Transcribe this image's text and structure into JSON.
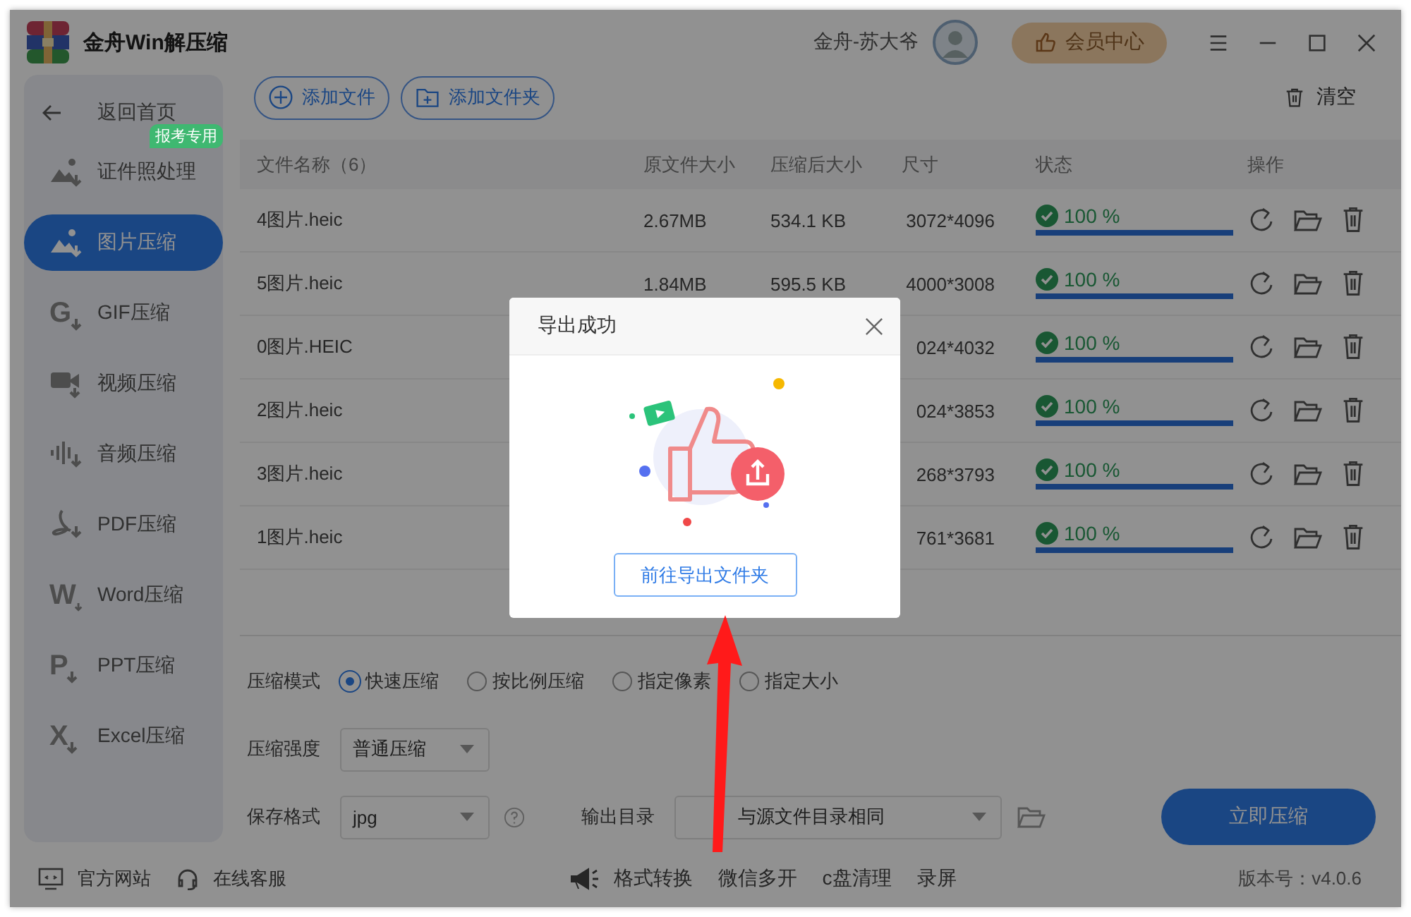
{
  "app": {
    "title": "金舟Win解压缩",
    "user": "金舟-苏大爷",
    "vip_button": "会员中心"
  },
  "sidebar": {
    "back": "返回首页",
    "items": [
      {
        "label": "证件照处理",
        "selected": false,
        "kind": "photo",
        "badge": "报考专用"
      },
      {
        "label": "图片压缩",
        "selected": true,
        "kind": "photo"
      },
      {
        "label": "GIF压缩",
        "selected": false,
        "kind": "letter",
        "icon_letter": "G"
      },
      {
        "label": "视频压缩",
        "selected": false,
        "kind": "video"
      },
      {
        "label": "音频压缩",
        "selected": false,
        "kind": "audio"
      },
      {
        "label": "PDF压缩",
        "selected": false,
        "kind": "pdf"
      },
      {
        "label": "Word压缩",
        "selected": false,
        "kind": "letter",
        "icon_letter": "W"
      },
      {
        "label": "PPT压缩",
        "selected": false,
        "kind": "letter",
        "icon_letter": "P"
      },
      {
        "label": "Excel压缩",
        "selected": false,
        "kind": "letter",
        "icon_letter": "X"
      }
    ]
  },
  "toolbar": {
    "add_file": "添加文件",
    "add_folder": "添加文件夹",
    "clear": "清空"
  },
  "table": {
    "columns": [
      "文件名称（6）",
      "原文件大小",
      "压缩后大小",
      "尺寸",
      "状态",
      "操作"
    ],
    "rows": [
      {
        "name": "4图片.heic",
        "original_size": "2.67MB",
        "compressed_size": "534.1 KB",
        "dimensions": "3072*4096",
        "status": "100 %",
        "level": 1
      },
      {
        "name": "5图片.heic",
        "original_size": "1.84MB",
        "compressed_size": "595.5 KB",
        "dimensions": "4000*3008",
        "status": "100 %",
        "level": 1
      },
      {
        "name": "0图片.HEIC",
        "dimensions": "024*4032",
        "status": "100 %",
        "level": 1
      },
      {
        "name": "2图片.heic",
        "dimensions": "024*3853",
        "status": "100 %",
        "level": 1
      },
      {
        "name": "3图片.heic",
        "dimensions": "268*3793",
        "status": "100 %",
        "level": 1
      },
      {
        "name": "1图片.heic",
        "dimensions": "761*3681",
        "status": "100 %",
        "level": 1
      }
    ]
  },
  "settings": {
    "mode_label": "压缩模式",
    "modes": [
      {
        "label": "快速压缩",
        "selected": true
      },
      {
        "label": "按比例压缩",
        "selected": false
      },
      {
        "label": "指定像素",
        "selected": false
      },
      {
        "label": "指定大小",
        "selected": false
      }
    ],
    "strength_label": "压缩强度",
    "strength": "普通压缩",
    "format_label": "保存格式",
    "format": "jpg",
    "output_label": "输出目录",
    "output": "与源文件目录相同",
    "compress_button": "立即压缩"
  },
  "footer": {
    "website": "官方网站",
    "support": "在线客服",
    "tools": [
      "格式转换",
      "微信多开",
      "c盘清理",
      "录屏"
    ],
    "version": "版本号：v4.0.6"
  },
  "dialog": {
    "title": "导出成功",
    "button": "前往导出文件夹"
  }
}
